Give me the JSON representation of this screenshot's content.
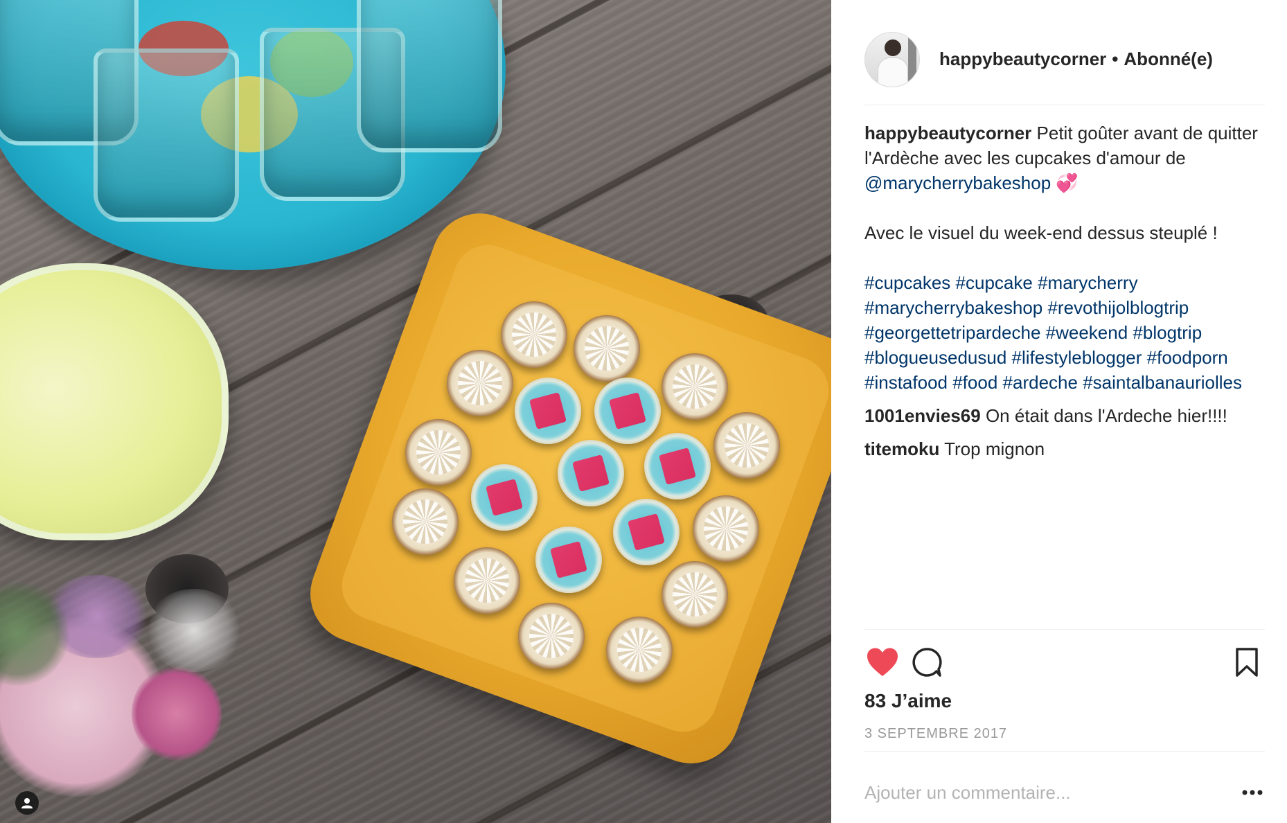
{
  "post": {
    "author": "happybeautycorner",
    "separator": "•",
    "follow_status": "Abonné(e)"
  },
  "caption": {
    "username": "happybeautycorner",
    "text_1": "Petit goûter avant de quitter l'Ardèche avec les cupcakes d'amour de",
    "mention": "@marycherrybakeshop",
    "emoji": "💞",
    "text_2": "Avec le visuel du week-end dessus steuplé !",
    "hashtags": [
      "#cupcakes",
      "#cupcake",
      "#marycherry",
      "#marycherrybakeshop",
      "#revothijolblogtrip",
      "#georgettetripardeche",
      "#weekend",
      "#blogtrip",
      "#blogueusedusud",
      "#lifestyleblogger",
      "#foodporn",
      "#instafood",
      "#food",
      "#ardeche",
      "#saintalbanauriolles"
    ]
  },
  "comments": [
    {
      "username": "1001envies69",
      "text": "On était dans l'Ardeche hier!!!!"
    },
    {
      "username": "titemoku",
      "text": "Trop mignon"
    }
  ],
  "actions": {
    "like_icon": "heart-icon",
    "comment_icon": "speech-bubble-icon",
    "save_icon": "bookmark-icon",
    "liked": true
  },
  "likes_text": "83 J’aime",
  "date_text": "3 SEPTEMBRE 2017",
  "comment_form": {
    "placeholder": "Ajouter un commentaire...",
    "more_icon": "ellipsis-icon"
  },
  "colors": {
    "like_red": "#ed4956",
    "link_blue": "#003569",
    "text": "#262626",
    "muted": "#999999"
  }
}
